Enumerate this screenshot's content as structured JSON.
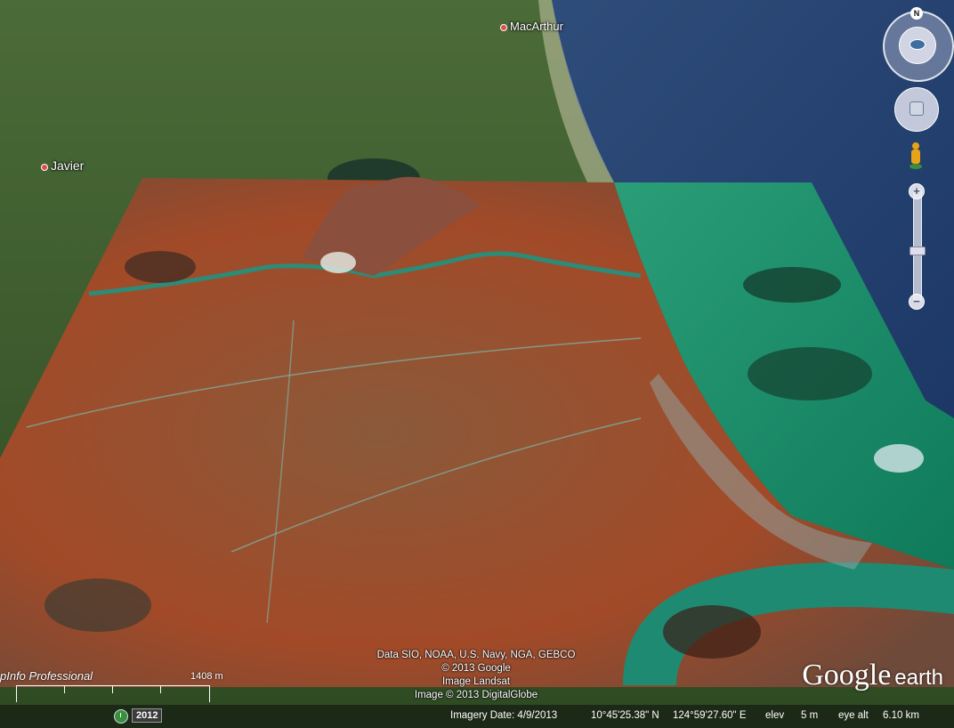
{
  "window": {
    "title": "Google Earth"
  },
  "places": [
    {
      "name": "MacArthur"
    },
    {
      "name": "Javier"
    }
  ],
  "credits": [
    "Data SIO, NOAA, U.S. Navy, NGA, GEBCO",
    "© 2013 Google",
    "Image Landsat",
    "Image © 2013 DigitalGlobe"
  ],
  "brand": {
    "google": "Google",
    "earth": "earth"
  },
  "edition_tag": "pInfo Professional",
  "scale": {
    "label": "1408 m"
  },
  "history": {
    "year": "2012"
  },
  "compass": {
    "north_label": "N"
  },
  "zoom": {
    "plus": "+",
    "minus": "−",
    "level": 0.45
  },
  "status": {
    "imagery_date": "Imagery Date: 4/9/2013",
    "lat": "10°45'25.38\" N",
    "lon": "124°59'27.60\" E",
    "elev_label": "elev",
    "elev_value": "5 m",
    "eye_alt_label": "eye alt",
    "eye_alt_value": "6.10 km"
  },
  "colors": {
    "land": "#3f5e2e",
    "ocean": "#23436f",
    "overlay_land": "#a04a2a",
    "overlay_water": "#1f8a66"
  }
}
